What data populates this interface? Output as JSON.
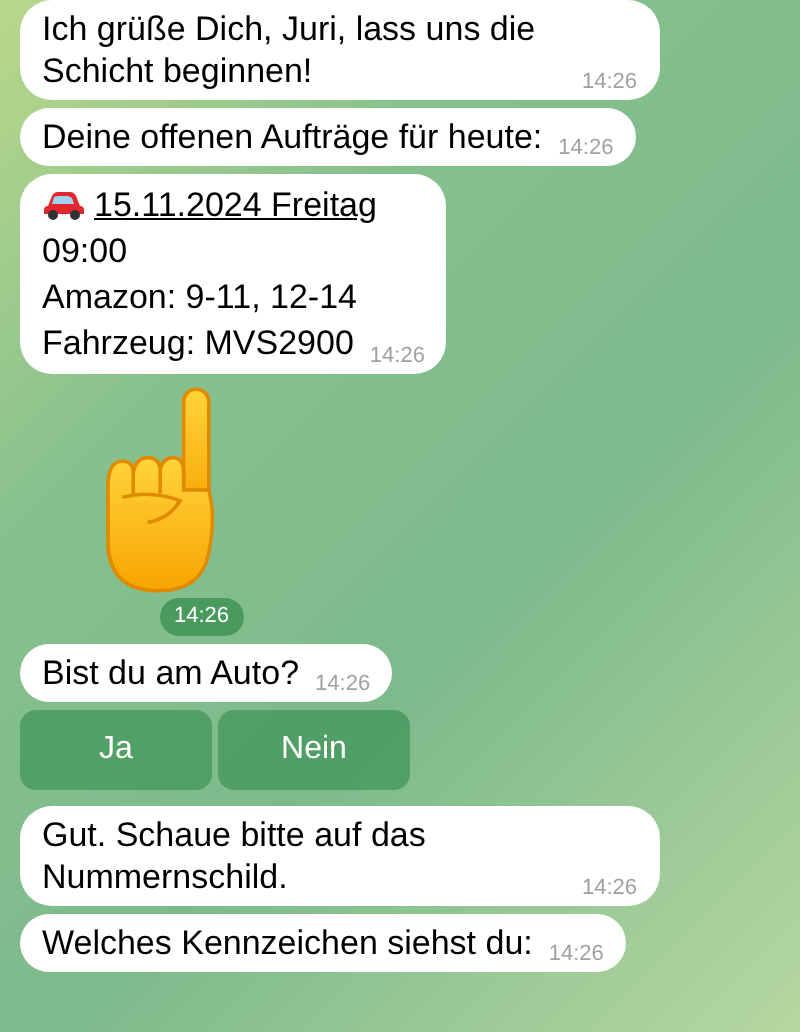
{
  "messages": [
    {
      "kind": "text",
      "text": "Ich grüße Dich, Juri, lass uns die Schicht beginnen!",
      "time": "14:26"
    },
    {
      "kind": "text",
      "text": "Deine offenen Aufträge für heute:",
      "time": "14:26"
    },
    {
      "kind": "order",
      "date": "15.11.2024 Freitag",
      "lines": [
        "09:00",
        "Amazon: 9-11, 12-14",
        "Fahrzeug: MVS2900"
      ],
      "time": "14:26"
    },
    {
      "kind": "sticker",
      "time": "14:26"
    },
    {
      "kind": "text",
      "text": "Bist du am Auto?",
      "time": "14:26"
    },
    {
      "kind": "buttons",
      "buttons": [
        "Ja",
        "Nein"
      ]
    },
    {
      "kind": "text",
      "text": "Gut. Schaue bitte auf das Nummernschild.",
      "time": "14:26"
    },
    {
      "kind": "text",
      "text": "Welches Kennzeichen siehst du:",
      "time": "14:26"
    }
  ]
}
